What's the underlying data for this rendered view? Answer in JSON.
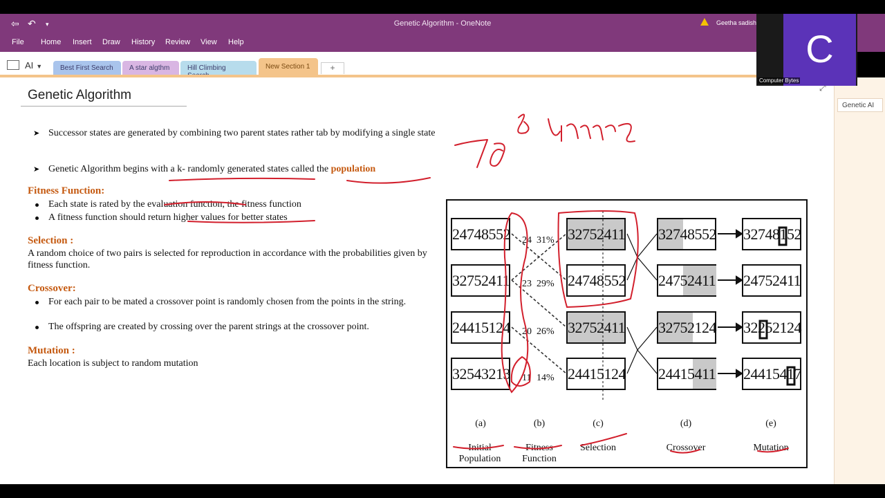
{
  "window": {
    "title": "Genetic Algorithm  -  OneNote",
    "user": "Geetha sadish"
  },
  "menu": [
    "File",
    "Home",
    "Insert",
    "Draw",
    "History",
    "Review",
    "View",
    "Help"
  ],
  "notebook": {
    "name": "AI"
  },
  "sections": [
    {
      "label": "Best First Search",
      "color": "#a9c4ec"
    },
    {
      "label": "A star algthm",
      "color": "#d9b6e3"
    },
    {
      "label": "Hill Climbing Search",
      "color": "#b7dcec"
    },
    {
      "label": "New Section 1",
      "color": "#f4c48a"
    }
  ],
  "add_section": "+",
  "pages": [
    "Genetic AI"
  ],
  "webcam": {
    "initial": "C",
    "name": "Computer Bytes"
  },
  "page": {
    "title": "Genetic Algorithm",
    "bullet1": "Successor states are generated by combining two parent states rather tab by modifying a single state",
    "bullet2_pre": "Genetic Algorithm begins  with  a k- randomly generated states called  the ",
    "bullet2_hl": "population",
    "fitness_heading": "Fitness Function:",
    "fitness_1": "Each state is rated  by the  evaluation function, the fitness function",
    "fitness_2": "A fitness function should return higher values for better states",
    "selection_heading": "Selection :",
    "selection_text": "A random choice of two pairs is selected for reproduction in accordance with the probabilities given by fitness function.",
    "crossover_heading": "Crossover:",
    "crossover_1": "For each pair to be mated a crossover point is randomly chosen from the points in the string.",
    "crossover_2": "The offspring are created by crossing over the parent strings at the crossover point.",
    "mutation_heading": "Mutation :",
    "mutation_text": "Each location is subject to random mutation"
  },
  "figure": {
    "population": [
      "24748552",
      "32752411",
      "24415124",
      "32543213"
    ],
    "fitness": [
      "24",
      "23",
      "20",
      "11"
    ],
    "percent": [
      "31%",
      "29%",
      "26%",
      "14%"
    ],
    "selection": [
      "32752411",
      "24748552",
      "32752411",
      "24415124"
    ],
    "crossover": [
      "32748552",
      "24752411",
      "32752124",
      "24415411"
    ],
    "mutation": [
      "32748152",
      "24752411",
      "32252124",
      "24415417"
    ],
    "letters": [
      "(a)",
      "(b)",
      "(c)",
      "(d)",
      "(e)"
    ],
    "captions": [
      "Initial Population",
      "Fitness Function",
      "Selection",
      "Crossover",
      "Mutation"
    ]
  },
  "ink": {
    "annotation": "8 queens",
    "number": "78"
  }
}
